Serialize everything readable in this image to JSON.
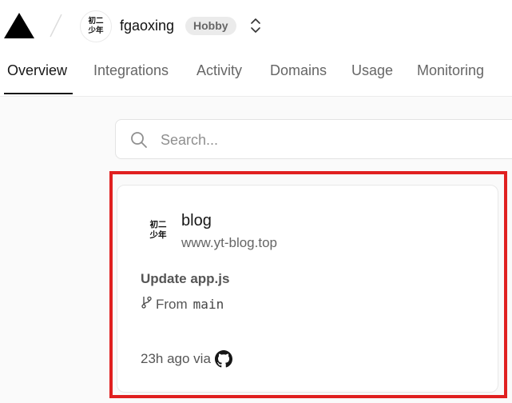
{
  "header": {
    "team": {
      "avatar_lines": [
        "初二",
        "少年"
      ],
      "name": "fgaoxing",
      "plan": "Hobby"
    }
  },
  "tabs": [
    {
      "label": "Overview",
      "active": true
    },
    {
      "label": "Integrations",
      "active": false
    },
    {
      "label": "Activity",
      "active": false
    },
    {
      "label": "Domains",
      "active": false
    },
    {
      "label": "Usage",
      "active": false
    },
    {
      "label": "Monitoring",
      "active": false
    }
  ],
  "search": {
    "placeholder": "Search..."
  },
  "project_card": {
    "avatar_lines": [
      "初二",
      "少年"
    ],
    "name": "blog",
    "domain": "www.yt-blog.top",
    "commit_message": "Update app.js",
    "from_label": "From",
    "branch": "main",
    "time_ago": "23h ago via"
  },
  "icons": {
    "logo": "triangle-logo-icon",
    "switcher": "chevron-up-down-icon",
    "search": "search-icon",
    "branch": "git-branch-icon",
    "source": "github-icon"
  },
  "colors": {
    "highlight": "#e02020",
    "active_tab": "#171717",
    "muted_text": "#666666",
    "background": "#fafafa"
  }
}
